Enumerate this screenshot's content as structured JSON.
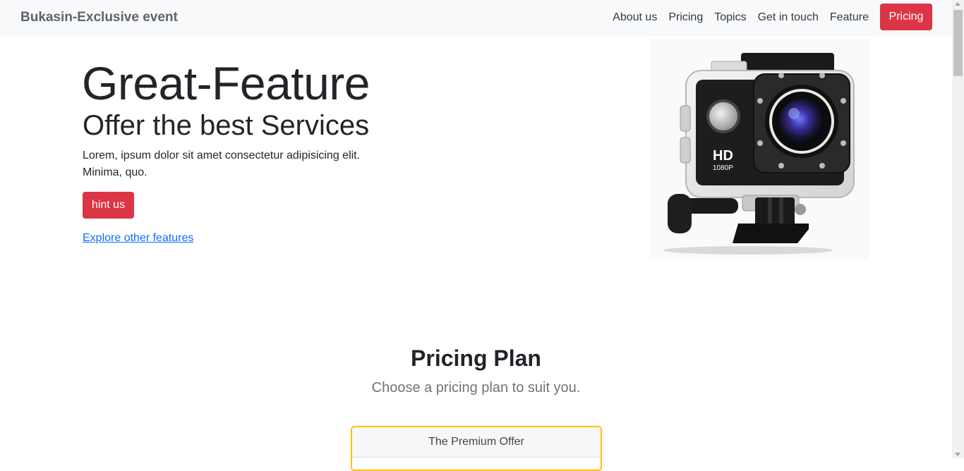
{
  "navbar": {
    "brand": "Bukasin-Exclusive event",
    "links": [
      "About us",
      "Pricing",
      "Topics",
      "Get in touch",
      "Feature"
    ],
    "button_label": "Pricing"
  },
  "hero": {
    "title": "Great-Feature",
    "subtitle": "Offer the best Services",
    "text": "Lorem, ipsum dolor sit amet consectetur adipisicing elit. Minima, quo.",
    "button_label": "hint us",
    "link_label": "Explore other features",
    "camera_badge": "HD",
    "camera_resolution": "1080P"
  },
  "pricing": {
    "title": "Pricing Plan",
    "subtitle": "Choose a pricing plan to suit you.",
    "card_header": "The Premium Offer"
  },
  "colors": {
    "accent": "#dc3545",
    "card_border": "#ffc107",
    "link": "#0d6efd"
  }
}
